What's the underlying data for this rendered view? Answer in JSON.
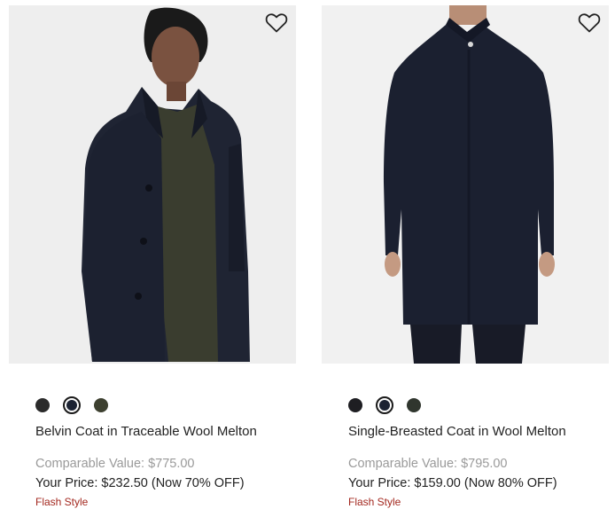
{
  "products": [
    {
      "name": "Belvin Coat in Traceable Wool Melton",
      "comparable": "Comparable Value: $775.00",
      "price": "Your Price: $232.50 (Now 70% OFF)",
      "tag": "Flash Style",
      "swatch_colors": [
        "#2b2b2b",
        "#1c2333",
        "#3d4030"
      ],
      "selected_swatch": 1,
      "wishlist_icon": "heart-outline-icon"
    },
    {
      "name": "Single-Breasted Coat in Wool Melton",
      "comparable": "Comparable Value: $795.00",
      "price": "Your Price: $159.00 (Now 80% OFF)",
      "tag": "Flash Style",
      "swatch_colors": [
        "#1e1e22",
        "#1c2333",
        "#30362e"
      ],
      "selected_swatch": 1,
      "wishlist_icon": "heart-outline-icon"
    }
  ],
  "colors": {
    "flash_tag": "#a3281f",
    "comparable_text": "#9a9a9a",
    "image_background": "#efefef"
  }
}
